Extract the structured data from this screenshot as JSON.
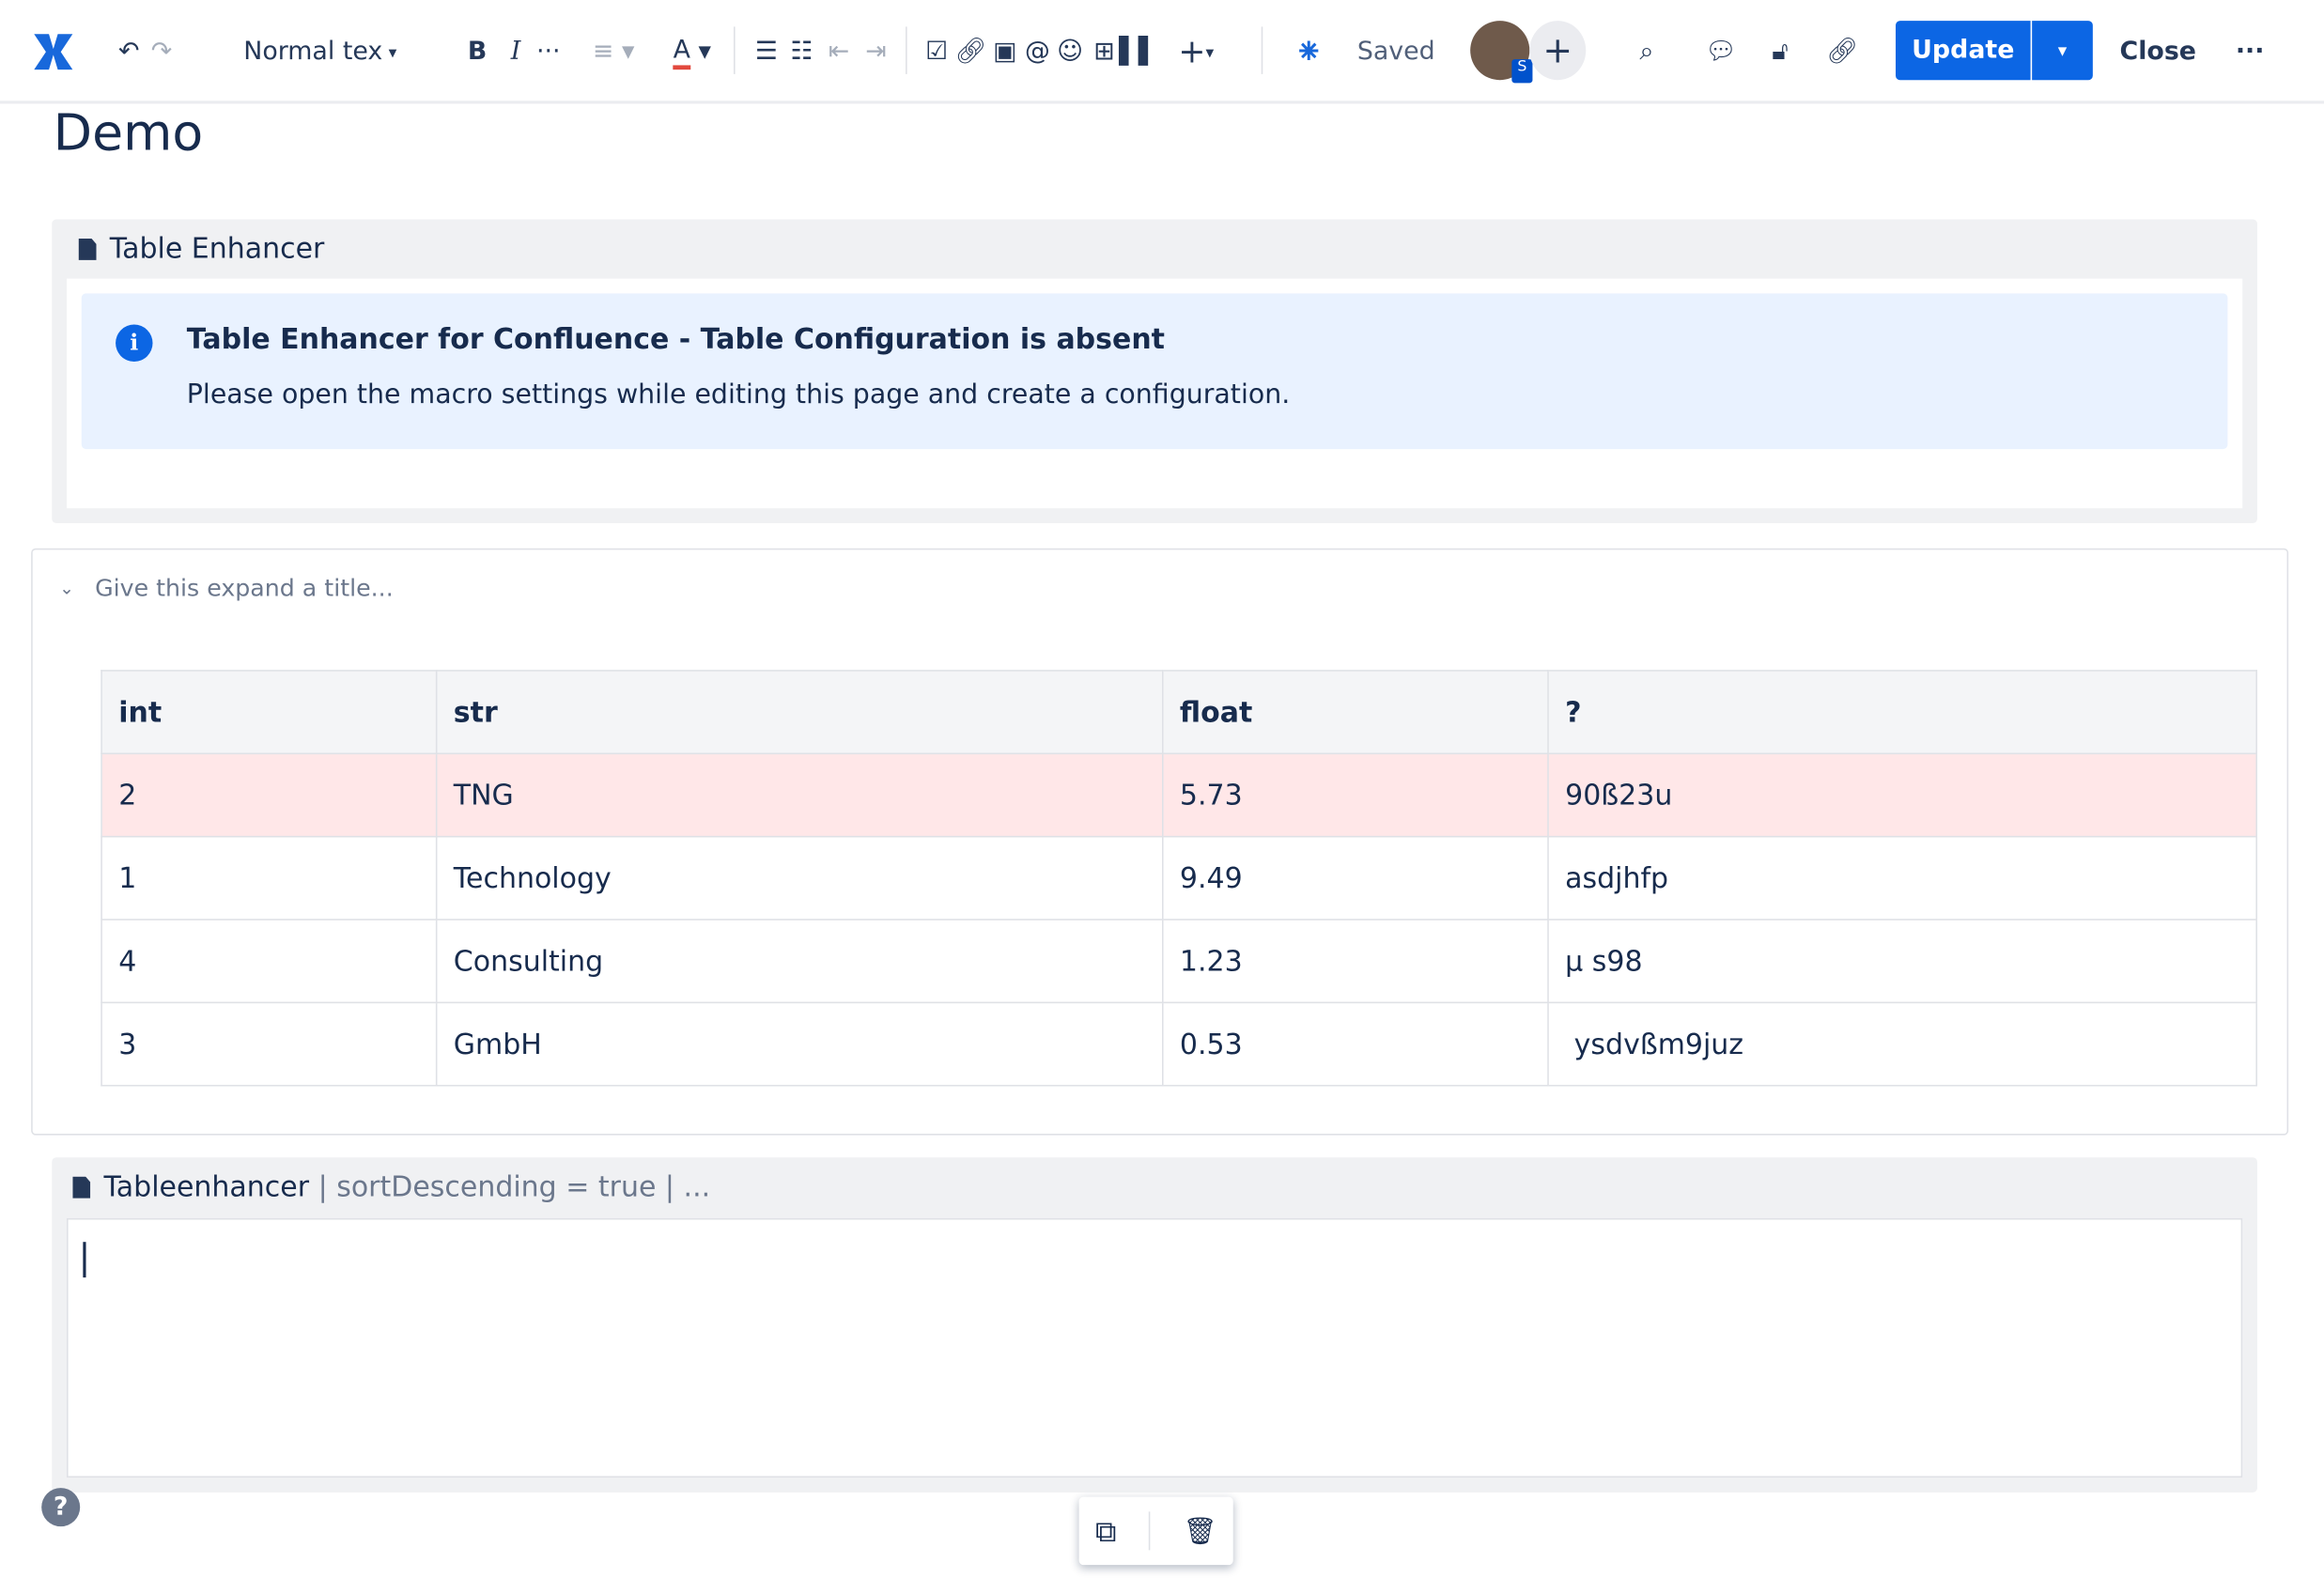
{
  "toolbar": {
    "text_style": "Normal tex",
    "saved": "Saved",
    "avatar_badge": "S",
    "update": "Update",
    "close": "Close",
    "more": "···"
  },
  "page": {
    "title": "Demo"
  },
  "macro1": {
    "title": "Table Enhancer",
    "info_title": "Table Enhancer for Confluence - Table Configuration is absent",
    "info_text": "Please open the macro settings while editing this page and create a configuration."
  },
  "expand": {
    "placeholder": "Give this expand a title..."
  },
  "table": {
    "headers": [
      "int",
      "str",
      "float",
      "?"
    ],
    "rows": [
      [
        "2",
        "TNG",
        "5.73",
        "90ß23u"
      ],
      [
        "1",
        "Technology",
        "9.49",
        "asdjhfp"
      ],
      [
        "4",
        "Consulting",
        "1.23",
        "µ s98"
      ],
      [
        "3",
        "GmbH",
        "0.53",
        " ysdvßm9juz"
      ]
    ]
  },
  "macro2": {
    "title": "Tableenhancer",
    "params": " | sortDescending = true | ..."
  },
  "colors": {
    "accent": "#0c66e4",
    "highlight_row": "#ffe7e8",
    "info_bg": "#e9f2ff"
  }
}
